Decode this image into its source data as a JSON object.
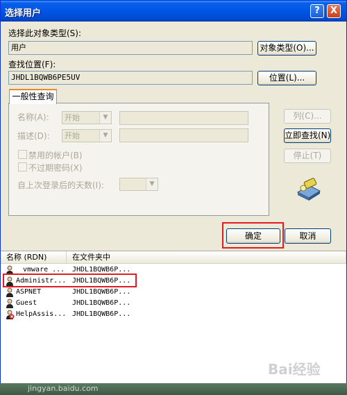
{
  "title": "选择用户",
  "help_button": "?",
  "close_button": "X",
  "object_type": {
    "label": "选择此对象类型(S):",
    "value": "用户",
    "button": "对象类型(O)..."
  },
  "location": {
    "label": "查找位置(F):",
    "value": "JHDL1BQWB6PE5UV",
    "button": "位置(L)..."
  },
  "tab_label": "一般性查询",
  "query": {
    "name_label": "名称(A):",
    "name_mode": "开始",
    "desc_label": "描述(D):",
    "desc_mode": "开始",
    "disabled_accounts": "禁用的帐户(B)",
    "no_expire_pwd": "不过期密码(X)",
    "days_since_login": "自上次登录后的天数(I):"
  },
  "side_buttons": {
    "columns": "列(C)...",
    "find_now": "立即查找(N)",
    "stop": "停止(T)"
  },
  "ok_button": "确定",
  "cancel_button": "取消",
  "results": {
    "headers": [
      "名称 (RDN)",
      "在文件夹中"
    ],
    "rows": [
      {
        "name": "vmware ...",
        "folder": "JHDL1BQWB6P..."
      },
      {
        "name": "Administr...",
        "folder": "JHDL1BQWB6P..."
      },
      {
        "name": "ASPNET",
        "folder": "JHDL1BQWB6P..."
      },
      {
        "name": "Guest",
        "folder": "JHDL1BQWB6P..."
      },
      {
        "name": "HelpAssis...",
        "folder": "JHDL1BQWB6P..."
      }
    ]
  },
  "watermark": "Bai经验",
  "taskbar_text": "jingyan.baidu.com",
  "colors": {
    "titlebar": "#0055e5",
    "highlight": "#e01b24",
    "dialog_bg": "#ece9d8"
  }
}
